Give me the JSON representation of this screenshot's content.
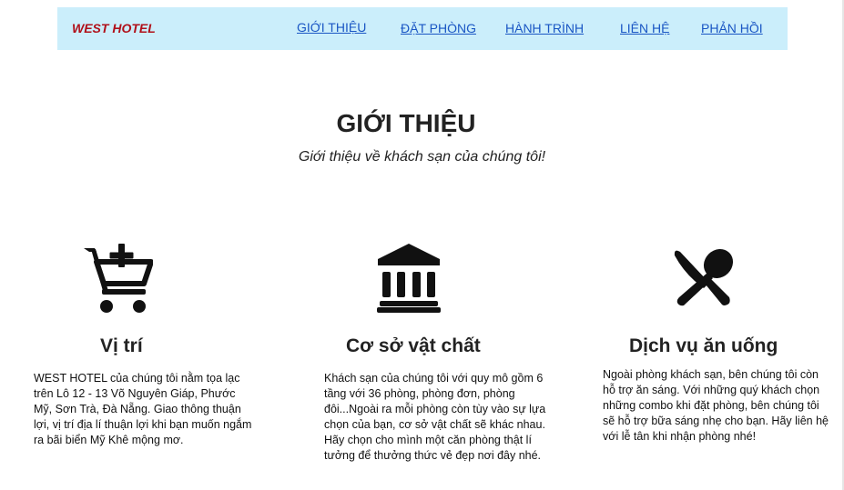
{
  "navbar": {
    "brand": "WEST HOTEL",
    "links": [
      {
        "label": "GIỚI THIỆU"
      },
      {
        "label": "ĐẶT PHÒNG"
      },
      {
        "label": "HÀNH TRÌNH"
      },
      {
        "label": "LIÊN HỆ"
      },
      {
        "label": "PHẢN HỒI"
      }
    ]
  },
  "hero": {
    "title": "GIỚI THIỆU",
    "subtitle": "Giới thiệu về khách sạn của chúng tôi!"
  },
  "features": [
    {
      "icon": "cart-plus-icon",
      "title": "Vị trí",
      "text": "WEST HOTEL của chúng tôi nằm tọa lạc trên Lô 12 - 13 Võ Nguyên Giáp, Phước Mỹ, Sơn Trà, Đà Nẵng. Giao thông thuận lợi, vị trí địa lí thuận lợi khi bạn muốn ngắm ra bãi biển Mỹ Khê mộng mơ."
    },
    {
      "icon": "building-columns-icon",
      "title": "Cơ sở vật chất",
      "text": "Khách sạn của chúng tôi với quy mô gồm 6 tầng với 36 phòng, phòng đơn, phòng đôi...Ngoài ra mỗi phòng còn tùy vào sự lựa chọn của bạn, cơ sở vật chất sẽ khác nhau. Hãy chọn cho mình một căn phòng thật lí tưởng để thưởng thức vẻ đẹp nơi đây nhé."
    },
    {
      "icon": "utensils-spoon-knife-icon",
      "title": "Dịch vụ ăn uống",
      "text": "Ngoài phòng khách sạn, bên chúng tôi còn hỗ trợ ăn sáng. Với những quý khách chọn những combo khi đặt phòng, bên chúng tôi sẽ hỗ trợ bữa sáng nhẹ cho bạn. Hãy liên hệ với lễ tân khi nhận phòng nhé!"
    }
  ],
  "colors": {
    "navbar_bg": "#cbeefb",
    "brand": "#b0101a",
    "link": "#1a56c4"
  }
}
